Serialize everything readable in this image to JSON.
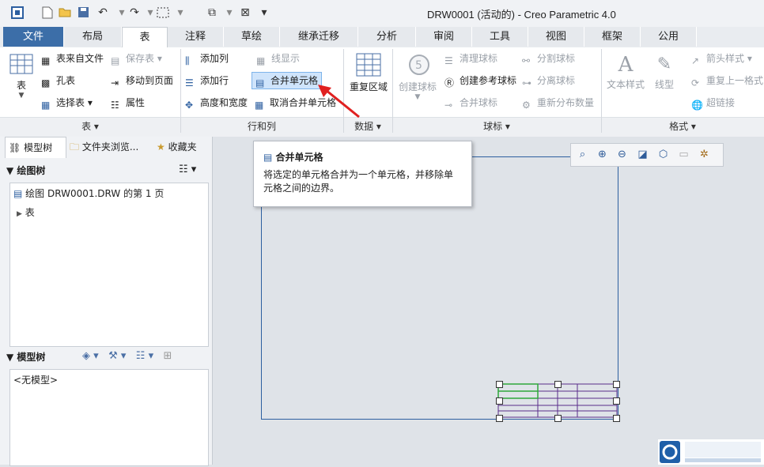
{
  "window": {
    "title": "DRW0001 (活动的) - Creo Parametric 4.0"
  },
  "tabs": [
    {
      "label": "文件"
    },
    {
      "label": "布局"
    },
    {
      "label": "表"
    },
    {
      "label": "注释"
    },
    {
      "label": "草绘"
    },
    {
      "label": "继承迁移"
    },
    {
      "label": "分析"
    },
    {
      "label": "审阅"
    },
    {
      "label": "工具"
    },
    {
      "label": "视图"
    },
    {
      "label": "框架"
    },
    {
      "label": "公用"
    }
  ],
  "ribbon": {
    "table_group": {
      "big_label": "表",
      "table_from_file": "表来自文件",
      "save_table": "保存表",
      "hole_table": "孔表",
      "move_to_page": "移动到页面",
      "select_table": "选择表",
      "properties": "属性",
      "group_label": "表"
    },
    "rows_cols_group": {
      "add_column": "添加列",
      "line_display": "线显示",
      "add_row": "添加行",
      "merge_cells": "合并单元格",
      "height_width": "高度和宽度",
      "unmerge_cells": "取消合并单元格",
      "group_label": "行和列"
    },
    "data_group": {
      "repeat_region": "重复区域",
      "group_label": "数据"
    },
    "balloon_group": {
      "create_balloon": "创建球标",
      "clean_balloons": "清理球标",
      "create_ref_balloon": "创建参考球标",
      "merge_balloons": "合并球标",
      "split_balloons": "分割球标",
      "detach_balloons": "分离球标",
      "redistribute": "重新分布数量",
      "group_label": "球标"
    },
    "format_group": {
      "text_style": "文本样式",
      "line_style": "线型",
      "arrow_style": "箭头样式",
      "repeat_last_format": "重复上一格式",
      "hyperlink": "超链接",
      "group_label": "格式"
    }
  },
  "left_panel": {
    "tabs": [
      {
        "label": "模型树"
      },
      {
        "label": "文件夹浏览..."
      },
      {
        "label": "收藏夹"
      }
    ],
    "drawing_tree": {
      "title": "绘图树",
      "items": [
        {
          "label": "绘图 DRW0001.DRW 的第 1 页"
        },
        {
          "label": "表"
        }
      ]
    },
    "model_tree": {
      "title": "模型树",
      "empty_text": "<无模型>"
    }
  },
  "tooltip": {
    "title": "合并单元格",
    "body": "将选定的单元格合并为一个单元格，并移除单元格之间的边界。"
  },
  "colors": {
    "file_tab": "#3c6ea8",
    "drawing_border": "#2d5fa0",
    "table_lines": "#5a2c8a",
    "selected_cells": "#2fa83a",
    "arrow": "#e02020"
  }
}
